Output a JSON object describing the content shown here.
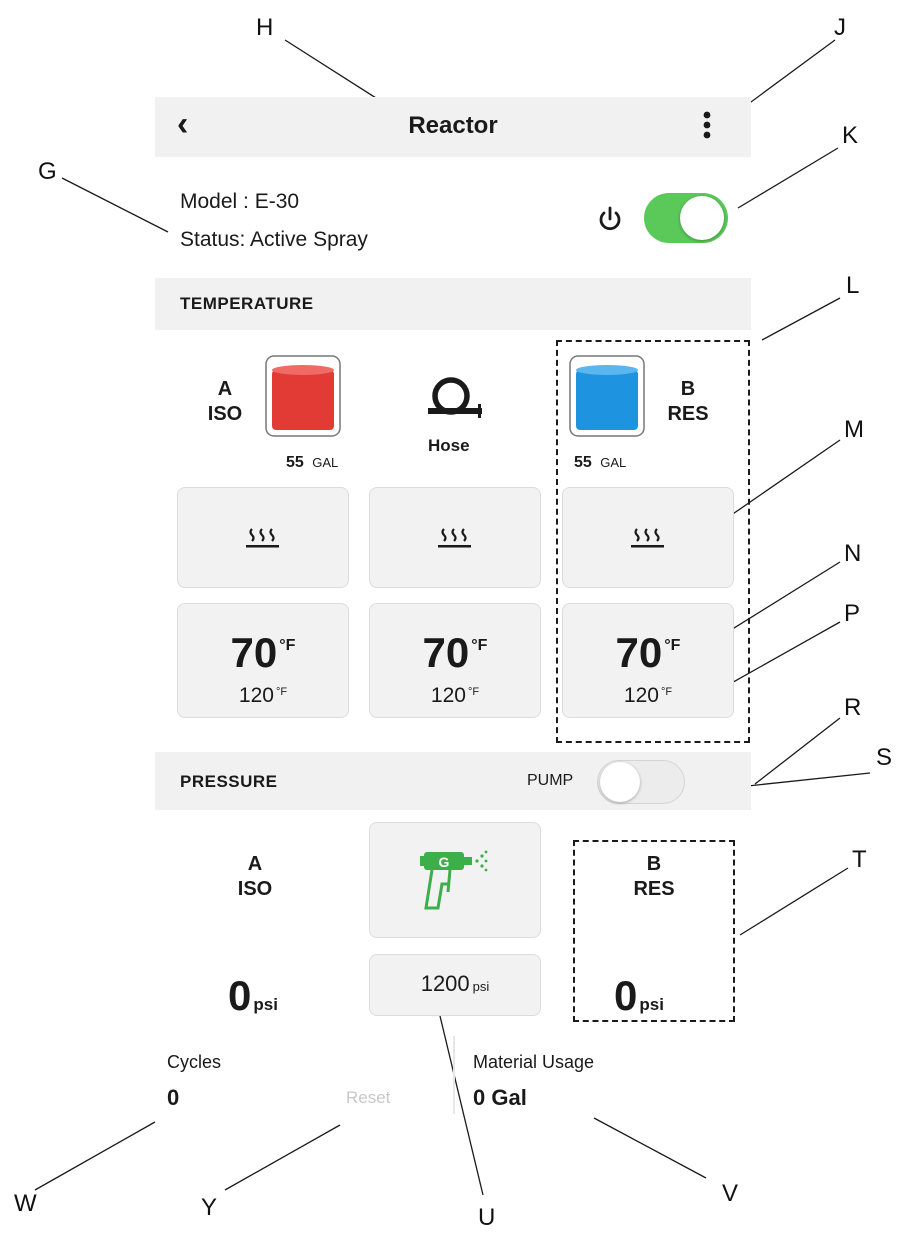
{
  "callouts": {
    "h": "H",
    "j": "J",
    "k": "K",
    "g": "G",
    "l": "L",
    "m": "M",
    "n": "N",
    "p": "P",
    "r": "R",
    "s": "S",
    "t": "T",
    "w": "W",
    "y": "Y",
    "u": "U",
    "v": "V"
  },
  "header": {
    "title": "Reactor",
    "back_glyph": "‹",
    "menu_glyph": "⋮"
  },
  "info": {
    "model": "Model : E-30",
    "status": "Status: Active Spray",
    "power_on": true
  },
  "temperature": {
    "section_label": "TEMPERATURE",
    "a": {
      "line1": "A",
      "line2": "ISO",
      "drum": "55",
      "unit": "GAL",
      "color": "#e23a35"
    },
    "hose": {
      "label": "Hose"
    },
    "b": {
      "line1": "B",
      "line2": "RES",
      "drum": "55",
      "unit": "GAL",
      "color": "#1e93e0"
    },
    "zones": [
      {
        "actual": "70",
        "unit": "°F",
        "target": "120",
        "target_unit": "°F"
      },
      {
        "actual": "70",
        "unit": "°F",
        "target": "120",
        "target_unit": "°F"
      },
      {
        "actual": "70",
        "unit": "°F",
        "target": "120",
        "target_unit": "°F"
      }
    ]
  },
  "pressure": {
    "section_label": "PRESSURE",
    "pump_label": "PUMP",
    "pump_on": false,
    "a": {
      "line1": "A",
      "line2": "ISO",
      "value": "0",
      "unit": "psi"
    },
    "b": {
      "line1": "B",
      "line2": "RES",
      "value": "0",
      "unit": "psi"
    },
    "gun_letter": "G",
    "setpoint": "1200",
    "setpoint_unit": "psi"
  },
  "cycles": {
    "label": "Cycles",
    "value": "0",
    "reset_label": "Reset"
  },
  "material": {
    "label": "Material Usage",
    "value": "0 Gal"
  },
  "colors": {
    "accent_green": "#5bc85a",
    "gun_green": "#3cae4a"
  }
}
